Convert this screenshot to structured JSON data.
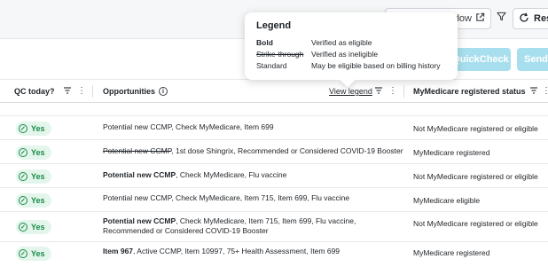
{
  "toolbar": {
    "new_window_label": "dow",
    "reset_label": "Rese"
  },
  "actionbar": {
    "quickcheck_label": "QuickCheck",
    "send_label": "Send D"
  },
  "columns": {
    "qc": "QC today?",
    "opportunities": "Opportunities",
    "view_legend": "View legend",
    "mymedicare": "MyMedicare registered status"
  },
  "rows": [
    {
      "qc": "Yes",
      "opp_bold": "",
      "opp_strike": "",
      "opp_rest": "Potential new CCMP, Check MyMedicare, Item 699",
      "mymed": "Not MyMedicare registered or eligible"
    },
    {
      "qc": "Yes",
      "opp_bold": "",
      "opp_strike": "Potential new CCMP",
      "opp_rest": ", 1st dose Shingrix, Recommended or Considered COVID-19 Booster",
      "mymed": "MyMedicare registered"
    },
    {
      "qc": "Yes",
      "opp_bold": "Potential new CCMP",
      "opp_strike": "",
      "opp_rest": ", Check MyMedicare, Flu vaccine",
      "mymed": "Not MyMedicare registered or eligible"
    },
    {
      "qc": "Yes",
      "opp_bold": "",
      "opp_strike": "",
      "opp_rest": "Potential new CCMP, Check MyMedicare, Item 715, Item 699, Flu vaccine",
      "mymed": "MyMedicare eligible"
    },
    {
      "qc": "Yes",
      "opp_bold": "Potential new CCMP",
      "opp_strike": "",
      "opp_rest": ", Check MyMedicare, Item 715, Item 699, Flu vaccine, Recommended or Considered COVID-19 Booster",
      "mymed": "Not MyMedicare registered or eligible"
    },
    {
      "qc": "Yes",
      "opp_bold": "Item 967",
      "opp_strike": "",
      "opp_rest": ", Active CCMP, Item 10997, 75+ Health Assessment, Item 699",
      "mymed": "MyMedicare registered"
    }
  ],
  "legend": {
    "title": "Legend",
    "items": [
      {
        "key": "Bold",
        "desc": "Verified as eligible"
      },
      {
        "key": "Strike-through",
        "desc": "Verified as ineligible"
      },
      {
        "key": "Standard",
        "desc": "May be eligible based on billing history"
      }
    ]
  },
  "colors": {
    "accent_light": "#a8dfee",
    "yes_green": "#1a8a4a",
    "yes_bg": "#e4f6ec"
  }
}
